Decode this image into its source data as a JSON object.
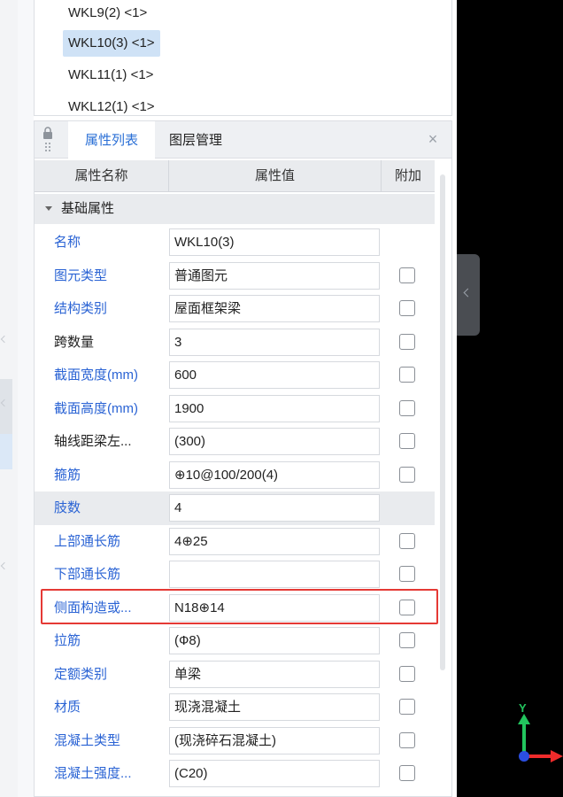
{
  "tree": {
    "items": [
      {
        "label": "WKL9(2) <1>",
        "selected": false
      },
      {
        "label": "WKL10(3) <1>",
        "selected": true
      },
      {
        "label": "WKL11(1) <1>",
        "selected": false
      },
      {
        "label": "WKL12(1) <1>",
        "selected": false
      }
    ]
  },
  "properties": {
    "tabs": [
      "属性列表",
      "图层管理"
    ],
    "columns": [
      "属性名称",
      "属性值",
      "附加"
    ],
    "group_label": "基础属性",
    "rows": [
      {
        "name": "名称",
        "value": "WKL10(3)",
        "link": true,
        "checkbox": false,
        "shaded": false
      },
      {
        "name": "图元类型",
        "value": "普通图元",
        "link": true,
        "checkbox": true,
        "shaded": false
      },
      {
        "name": "结构类别",
        "value": "屋面框架梁",
        "link": true,
        "checkbox": true,
        "shaded": false
      },
      {
        "name": "跨数量",
        "value": "3",
        "link": false,
        "checkbox": true,
        "shaded": false
      },
      {
        "name": "截面宽度(mm)",
        "value": "600",
        "link": true,
        "checkbox": true,
        "shaded": false
      },
      {
        "name": "截面高度(mm)",
        "value": "1900",
        "link": true,
        "checkbox": true,
        "shaded": false
      },
      {
        "name": "轴线距梁左...",
        "value": "(300)",
        "link": false,
        "checkbox": true,
        "shaded": false
      },
      {
        "name": "箍筋",
        "value": "⊕10@100/200(4)",
        "link": true,
        "checkbox": true,
        "shaded": false
      },
      {
        "name": "肢数",
        "value": "4",
        "link": true,
        "checkbox": false,
        "shaded": true
      },
      {
        "name": "上部通长筋",
        "value": "4⊕25",
        "link": true,
        "checkbox": true,
        "shaded": false
      },
      {
        "name": "下部通长筋",
        "value": "",
        "link": true,
        "checkbox": true,
        "shaded": false
      },
      {
        "name": "侧面构造或...",
        "value": "N18⊕14",
        "link": true,
        "checkbox": true,
        "shaded": false
      },
      {
        "name": "拉筋",
        "value": "(Ф8)",
        "link": true,
        "checkbox": true,
        "shaded": false
      },
      {
        "name": "定额类别",
        "value": "单梁",
        "link": true,
        "checkbox": true,
        "shaded": false
      },
      {
        "name": "材质",
        "value": "现浇混凝土",
        "link": true,
        "checkbox": true,
        "shaded": false
      },
      {
        "name": "混凝土类型",
        "value": "(现浇碎石混凝土)",
        "link": true,
        "checkbox": true,
        "shaded": false
      },
      {
        "name": "混凝土强度...",
        "value": "(C20)",
        "link": true,
        "checkbox": true,
        "shaded": false
      }
    ]
  },
  "viewport": {
    "axis_label_y": "Y",
    "colors": {
      "y_axis": "#22c55e",
      "x_axis": "#ef2b2b",
      "origin": "#2b4ee0",
      "highlight": "#e53935",
      "link_text": "#2a63d4"
    }
  }
}
